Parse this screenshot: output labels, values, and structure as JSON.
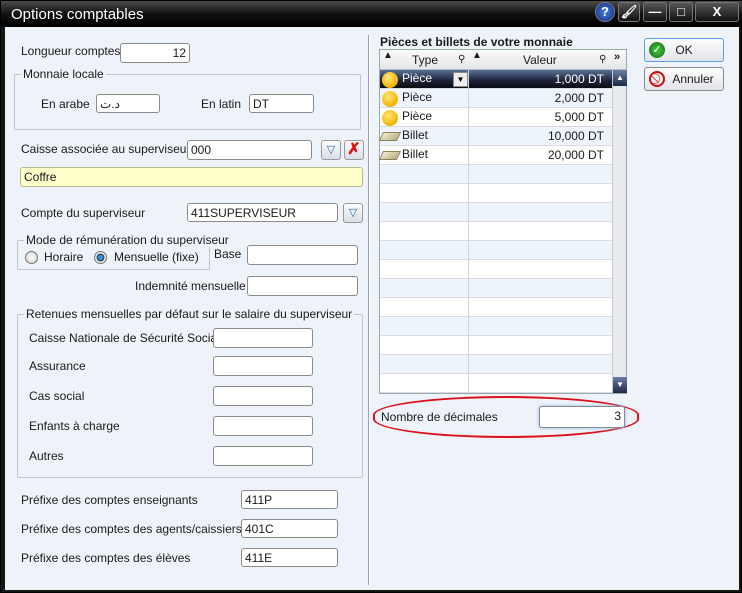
{
  "window": {
    "title": "Options comptables",
    "buttons": [
      "?",
      "—",
      "□",
      "X"
    ]
  },
  "general": {
    "longueur_label": "Longueur comptes",
    "longueur_value": "12"
  },
  "monnaie": {
    "group": "Monnaie locale",
    "arabe_label": "En arabe",
    "arabe_value": "د.ت",
    "latin_label": "En latin",
    "latin_value": "DT"
  },
  "caisse": {
    "label": "Caisse associée au superviseur",
    "value": "000",
    "name_value": "Coffre"
  },
  "compte": {
    "label": "Compte du superviseur",
    "value": "411SUPERVISEUR"
  },
  "remuneration": {
    "group": "Mode de rémunération du superviseur",
    "horaire": "Horaire",
    "mensuelle": "Mensuelle (fixe)",
    "selected": "Mensuelle (fixe)",
    "base_label": "Base",
    "base_value": "",
    "indemnite_label": "Indemnité mensuelle",
    "indemnite_value": ""
  },
  "retenues": {
    "group": "Retenues mensuelles par défaut sur le salaire du superviseur",
    "items": [
      {
        "label": "Caisse Nationale de Sécurité Sociale",
        "value": ""
      },
      {
        "label": "Assurance",
        "value": ""
      },
      {
        "label": "Cas social",
        "value": ""
      },
      {
        "label": "Enfants à charge",
        "value": ""
      },
      {
        "label": "Autres",
        "value": ""
      }
    ]
  },
  "prefixes": [
    {
      "label": "Préfixe des comptes enseignants",
      "value": "411P"
    },
    {
      "label": "Préfixe des comptes des agents/caissiers",
      "value": "401C"
    },
    {
      "label": "Préfixe des comptes des élèves",
      "value": "411E"
    }
  ],
  "monnaie_grid": {
    "title": "Pièces et billets de votre monnaie",
    "columns": [
      "Type",
      "Valeur"
    ],
    "rows": [
      {
        "type": "Pièce",
        "icon": "coin-icon",
        "value": "1,000 DT"
      },
      {
        "type": "Pièce",
        "icon": "coin-icon",
        "value": "2,000 DT"
      },
      {
        "type": "Pièce",
        "icon": "coin-icon",
        "value": "5,000 DT"
      },
      {
        "type": "Billet",
        "icon": "banknote-icon",
        "value": "10,000 DT"
      },
      {
        "type": "Billet",
        "icon": "banknote-icon",
        "value": "20,000 DT"
      }
    ]
  },
  "decimales": {
    "label": "Nombre de décimales",
    "value": "3",
    "highlight_color": "#e0101a"
  },
  "actions": {
    "ok": "OK",
    "cancel": "Annuler"
  }
}
